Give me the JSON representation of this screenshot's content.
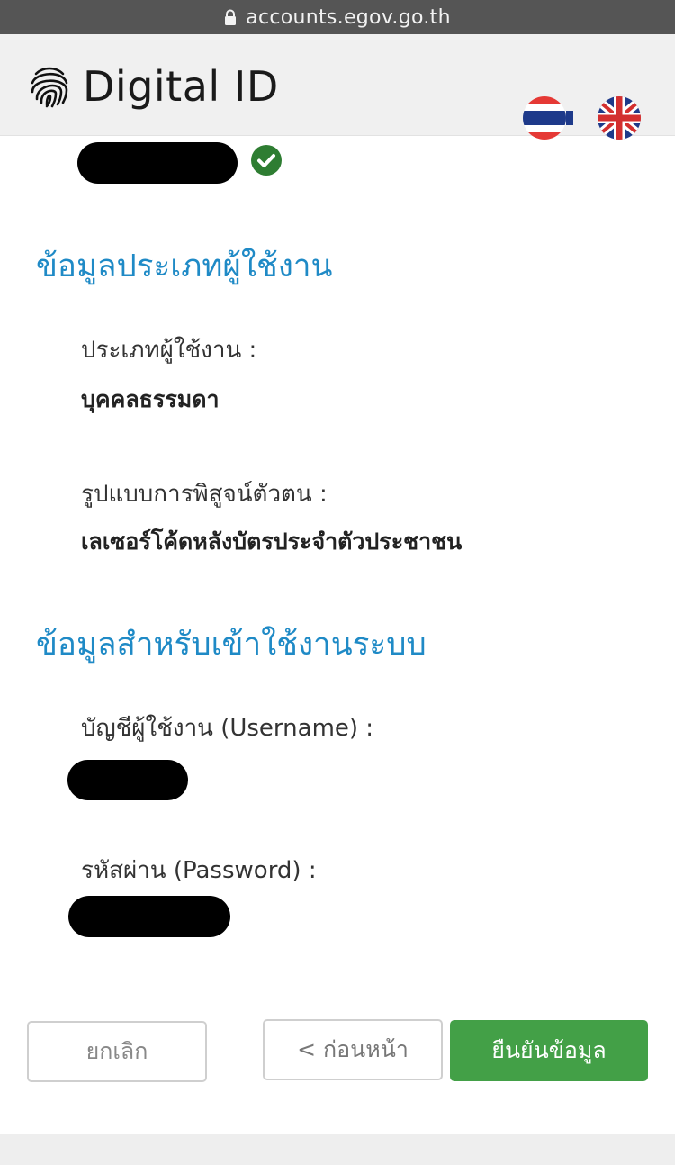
{
  "browser": {
    "url": "accounts.egov.go.th"
  },
  "header": {
    "title": "Digital ID",
    "languages": [
      "th",
      "en"
    ]
  },
  "section_user_type": {
    "title": "ข้อมูลประเภทผู้ใช้งาน",
    "user_type_label": "ประเภทผู้ใช้งาน :",
    "user_type_value": "บุคคลธรรมดา",
    "verification_label": "รูปแบบการพิสูจน์ตัวตน :",
    "verification_value": "เลเซอร์โค้ดหลังบัตรประจำตัวประชาชน"
  },
  "section_login": {
    "title": "ข้อมูลสำหรับเข้าใช้งานระบบ",
    "username_label": "บัญชีผู้ใช้งาน (Username) :",
    "password_label": "รหัสผ่าน (Password) :"
  },
  "buttons": {
    "cancel": "ยกเลิก",
    "previous": "< ก่อนหน้า",
    "confirm": "ยืนยันข้อมูล"
  },
  "colors": {
    "accent": "#1f8ac6",
    "confirm": "#43a047",
    "verified": "#2e7d32",
    "urlbar": "#555555",
    "header": "#f0f0f0"
  },
  "icons": {
    "lock": "lock-icon",
    "fingerprint": "fingerprint-icon",
    "verified": "check-circle-icon",
    "thai_flag": "thailand-flag-icon",
    "uk_flag": "uk-flag-icon"
  }
}
